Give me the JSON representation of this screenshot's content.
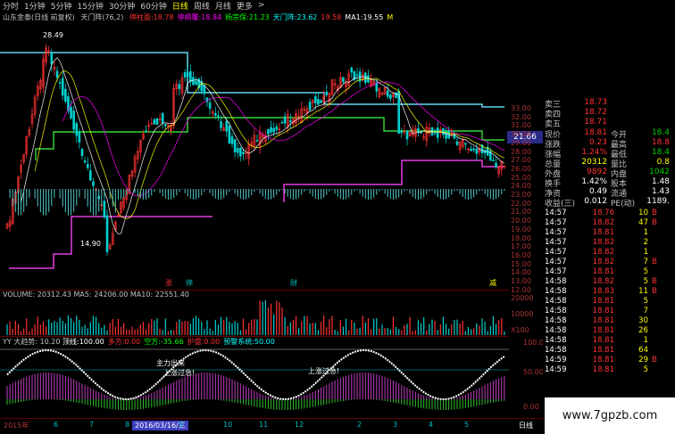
{
  "timeframes": {
    "items": [
      "分时",
      "1分钟",
      "5分钟",
      "15分钟",
      "30分钟",
      "60分钟",
      "日线",
      "周线",
      "月线",
      "更多"
    ],
    "active": "日线",
    "more_arrow": ">"
  },
  "title": {
    "stock": "山东金泰(日线 前复权)",
    "indicator": "天门阵(76,2)",
    "items": [
      {
        "label": "停柱面:",
        "value": "18.78",
        "color": "#ff3232"
      },
      {
        "label": "停柄覆:",
        "value": "18.84",
        "color": "#ff00ff"
      },
      {
        "label": "杨宗保:",
        "value": "21.23",
        "color": "#00ff00"
      },
      {
        "label": "天门阵:",
        "value": "23.62",
        "color": "#00ffff"
      },
      {
        "label": "",
        "value": "19.58",
        "color": "#ff3232"
      },
      {
        "label": "MA1:",
        "value": "19.55",
        "color": "#ffffff"
      },
      {
        "label": "M",
        "value": "",
        "color": "#ffff00"
      }
    ]
  },
  "main_chart": {
    "high_label": "28.49",
    "low_label": "14.90",
    "price_ticks": [
      "33.00",
      "32.00",
      "31.00",
      "30.00",
      "29.00",
      "28.00",
      "27.00",
      "26.00",
      "25.00",
      "24.00",
      "23.00",
      "22.00",
      "21.00",
      "20.00",
      "19.00",
      "18.00",
      "17.00",
      "16.00",
      "15.00",
      "14.00",
      "13.00",
      "12.00"
    ],
    "current_price_box": "21.66",
    "event_marks": [
      {
        "text": "涨",
        "color": "#ff3232"
      },
      {
        "text": "停",
        "color": "#00c0c0"
      },
      {
        "text": "财",
        "color": "#00c0c0"
      },
      {
        "text": "减",
        "color": "#ffff00"
      }
    ]
  },
  "volume": {
    "label": "VOLUME:",
    "value": "20312.43",
    "ma5_label": "MA5:",
    "ma5": "24206.00",
    "ma10_label": "MA10:",
    "ma10": "22551.40",
    "ticks": [
      "20000",
      "10000",
      "X100"
    ]
  },
  "indicator": {
    "name": "YY 大趋势:",
    "value": "10.20",
    "items": [
      {
        "label": "顶线:",
        "value": "100.00",
        "color": "#ffffff"
      },
      {
        "label": "多方:",
        "value": "0.00",
        "color": "#ff3232"
      },
      {
        "label": "空方:",
        "value": "-35.66",
        "color": "#00ff00"
      },
      {
        "label": "护盘:",
        "value": "0.00",
        "color": "#ff3232"
      },
      {
        "label": "预警系统:",
        "value": "50.00",
        "color": "#00ffff"
      }
    ],
    "annotations": [
      "主力出来",
      "上涨过急!",
      "上涨过急!"
    ],
    "ticks": [
      "100.00",
      "50.00",
      "0.00"
    ]
  },
  "bottom": {
    "year": "2015年",
    "date": "2016/03/16/三",
    "months": [
      "6",
      "7",
      "8",
      "9",
      "10",
      "11",
      "12",
      "2",
      "3",
      "4",
      "5"
    ],
    "period": "日线"
  },
  "quote": {
    "sell_rows": [
      {
        "label": "卖三",
        "value": "18.73"
      },
      {
        "label": "卖四",
        "value": "18.72"
      },
      {
        "label": "卖五",
        "value": "18.71"
      }
    ],
    "stats": [
      {
        "l1": "现价",
        "v1": "18.81",
        "c1": "red",
        "l2": "今开",
        "v2": "18.4",
        "c2": "green"
      },
      {
        "l1": "涨跌",
        "v1": "0.23",
        "c1": "red",
        "l2": "最高",
        "v2": "18.8",
        "c2": "red"
      },
      {
        "l1": "涨幅",
        "v1": "1.24%",
        "c1": "red",
        "l2": "最低",
        "v2": "18.4",
        "c2": "green"
      },
      {
        "l1": "总量",
        "v1": "20312",
        "c1": "yellow",
        "l2": "量比",
        "v2": "0.8",
        "c2": "yellow"
      },
      {
        "l1": "外盘",
        "v1": "9892",
        "c1": "red",
        "l2": "内盘",
        "v2": "1042",
        "c2": "green"
      },
      {
        "l1": "换手",
        "v1": "1.42%",
        "c1": "white",
        "l2": "股本",
        "v2": "1.48",
        "c2": "white"
      },
      {
        "l1": "净资",
        "v1": "0.49",
        "c1": "white",
        "l2": "流通",
        "v2": "1.43",
        "c2": "white"
      },
      {
        "l1": "收益(三)",
        "v1": "0.012",
        "c1": "white",
        "l2": "PE(动)",
        "v2": "1189.",
        "c2": "white"
      }
    ],
    "ticks": [
      {
        "time": "14:57",
        "price": "18.76",
        "vol": "10",
        "dir": "B"
      },
      {
        "time": "14:57",
        "price": "18.82",
        "vol": "47",
        "dir": "B"
      },
      {
        "time": "14:57",
        "price": "18.81",
        "vol": "1",
        "dir": ""
      },
      {
        "time": "14:57",
        "price": "18.82",
        "vol": "2",
        "dir": ""
      },
      {
        "time": "14:57",
        "price": "18.82",
        "vol": "1",
        "dir": ""
      },
      {
        "time": "14:57",
        "price": "18.82",
        "vol": "7",
        "dir": "B"
      },
      {
        "time": "14:57",
        "price": "18.81",
        "vol": "5",
        "dir": ""
      },
      {
        "time": "14:58",
        "price": "18.82",
        "vol": "5",
        "dir": "B"
      },
      {
        "time": "14:58",
        "price": "18.83",
        "vol": "11",
        "dir": "B"
      },
      {
        "time": "14:58",
        "price": "18.81",
        "vol": "5",
        "dir": ""
      },
      {
        "time": "14:58",
        "price": "18.81",
        "vol": "7",
        "dir": ""
      },
      {
        "time": "14:58",
        "price": "18.81",
        "vol": "30",
        "dir": ""
      },
      {
        "time": "14:58",
        "price": "18.81",
        "vol": "26",
        "dir": ""
      },
      {
        "time": "14:58",
        "price": "18.81",
        "vol": "1",
        "dir": ""
      },
      {
        "time": "14:58",
        "price": "18.81",
        "vol": "64",
        "dir": ""
      },
      {
        "time": "14:59",
        "price": "18.81",
        "vol": "29",
        "dir": "B"
      },
      {
        "time": "14:59",
        "price": "18.81",
        "vol": "5",
        "dir": ""
      }
    ]
  },
  "watermark": "www.7gpzb.com"
}
